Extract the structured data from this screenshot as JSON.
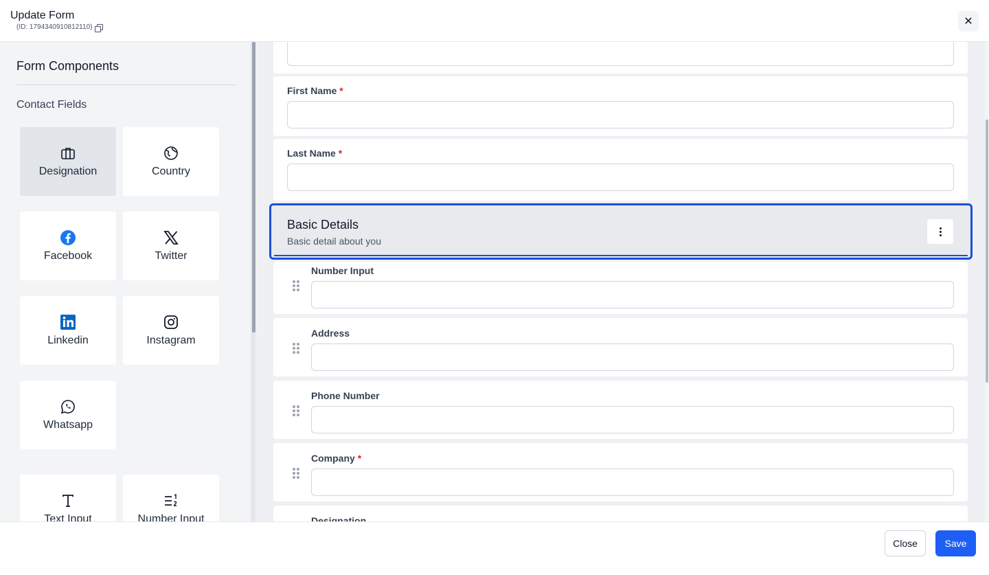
{
  "header": {
    "title": "Update Form",
    "id_text": "(ID: 1794340910812110)",
    "close_icon": "close-icon"
  },
  "sidebar": {
    "title": "Form Components",
    "section_label": "Contact Fields",
    "tiles": [
      {
        "label": "Designation",
        "icon": "briefcase-icon",
        "active": true
      },
      {
        "label": "Country",
        "icon": "globe-icon"
      },
      {
        "label": "Facebook",
        "icon": "facebook-icon"
      },
      {
        "label": "Twitter",
        "icon": "x-icon"
      },
      {
        "label": "Linkedin",
        "icon": "linkedin-icon"
      },
      {
        "label": "Instagram",
        "icon": "instagram-icon"
      },
      {
        "label": "Whatsapp",
        "icon": "whatsapp-icon"
      },
      {
        "label": "Text Input",
        "icon": "text-icon"
      },
      {
        "label": "Number Input",
        "icon": "number-list-icon"
      }
    ]
  },
  "main": {
    "fields_top": [
      {
        "label": "First Name",
        "required": "*"
      },
      {
        "label": "Last Name",
        "required": "*"
      }
    ],
    "section": {
      "title": "Basic Details",
      "description": "Basic detail about you"
    },
    "fields_section": [
      {
        "label": "Number Input",
        "required": ""
      },
      {
        "label": "Address",
        "required": ""
      },
      {
        "label": "Phone Number",
        "required": ""
      },
      {
        "label": "Company",
        "required": "*"
      },
      {
        "label": "Designation",
        "required": ""
      }
    ]
  },
  "footer": {
    "close_label": "Close",
    "save_label": "Save"
  },
  "colors": {
    "accent": "#1d5ff5",
    "required": "#dc2626",
    "section_border": "#1d4ed8"
  }
}
